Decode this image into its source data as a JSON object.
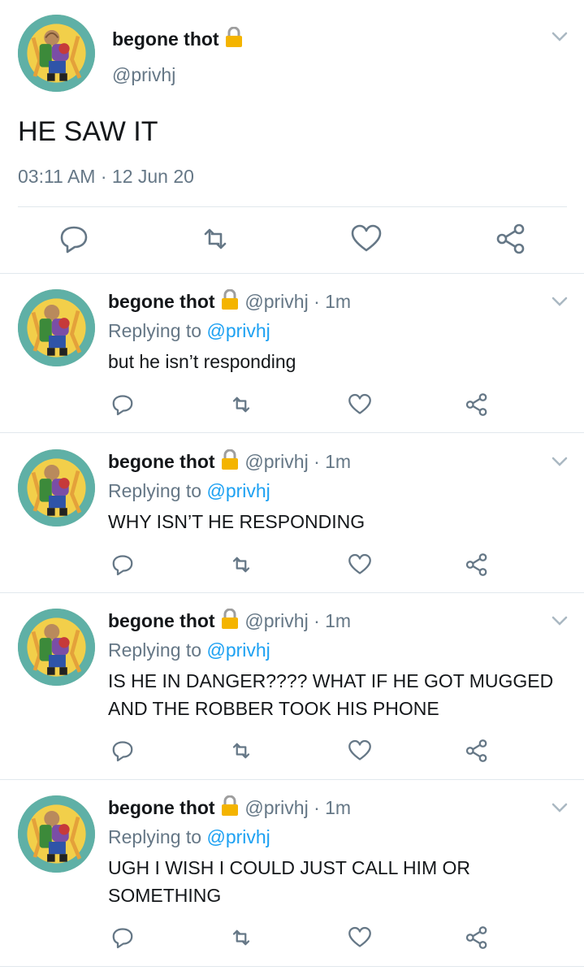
{
  "main_tweet": {
    "display_name": "begone thot",
    "handle": "@privhj",
    "text": "HE SAW IT",
    "timestamp": "03:11 AM · 12 Jun 20"
  },
  "replies": [
    {
      "display_name": "begone thot",
      "handle": "@privhj",
      "dot": "·",
      "time": "1m",
      "replying_prefix": "Replying to",
      "replying_to": "@privhj",
      "text": "but he isn’t responding"
    },
    {
      "display_name": "begone thot",
      "handle": "@privhj",
      "dot": "·",
      "time": "1m",
      "replying_prefix": "Replying to",
      "replying_to": "@privhj",
      "text": "WHY ISN’T HE RESPONDING"
    },
    {
      "display_name": "begone thot",
      "handle": "@privhj",
      "dot": "·",
      "time": "1m",
      "replying_prefix": "Replying to",
      "replying_to": "@privhj",
      "text": "IS HE IN DANGER???? WHAT IF HE GOT MUGGED AND THE ROBBER TOOK HIS PHONE"
    },
    {
      "display_name": "begone thot",
      "handle": "@privhj",
      "dot": "·",
      "time": "1m",
      "replying_prefix": "Replying to",
      "replying_to": "@privhj",
      "text": "UGH I WISH I COULD JUST CALL HIM OR SOMETHING"
    }
  ],
  "icons": {
    "lock": "lock-icon",
    "more": "chevron-down-icon",
    "reply": "reply-icon",
    "retweet": "retweet-icon",
    "like": "heart-icon",
    "share": "share-icon"
  },
  "colors": {
    "text": "#14171a",
    "secondary": "#657786",
    "link": "#1da1f2",
    "divider": "#e1e8ed",
    "lock": "#f4b400"
  }
}
